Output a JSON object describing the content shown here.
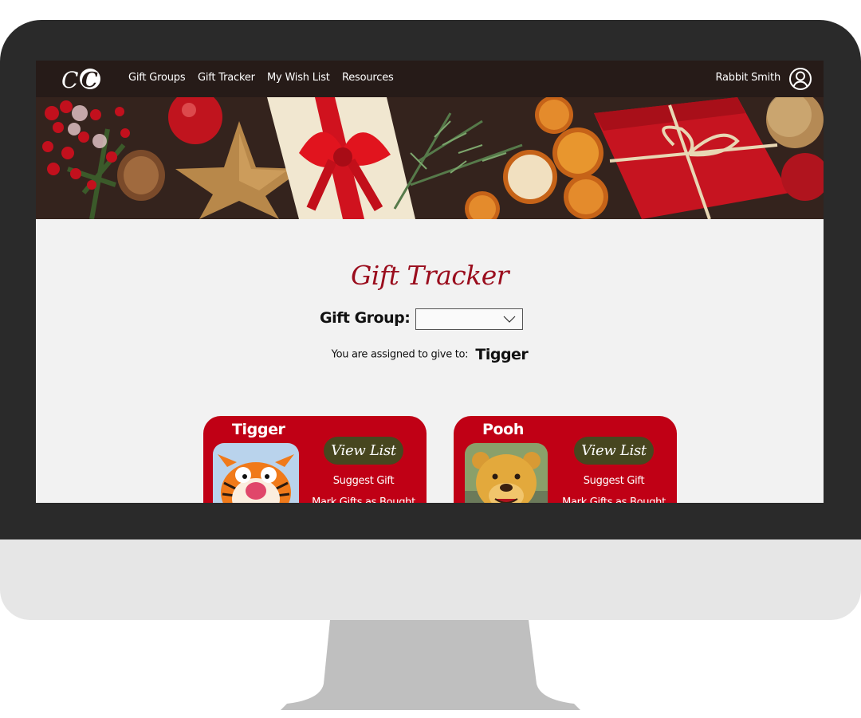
{
  "app": {
    "logo_text": "CC",
    "nav": [
      {
        "label": "Gift Groups"
      },
      {
        "label": "Gift Tracker"
      },
      {
        "label": "My Wish List"
      },
      {
        "label": "Resources"
      }
    ],
    "user_name": "Rabbit Smith",
    "user_icon": "user-circle-icon"
  },
  "page": {
    "title": "Gift Tracker",
    "gift_group_label": "Gift Group:",
    "gift_group_value": "",
    "assigned_label": "You are assigned to give to:",
    "assigned_name": "Tigger"
  },
  "cards": [
    {
      "name": "Tigger",
      "view_label": "View List",
      "suggest_label": "Suggest Gift",
      "mark_label": "Mark Gifts as Bought"
    },
    {
      "name": "Pooh",
      "view_label": "View List",
      "suggest_label": "Suggest Gift",
      "mark_label": "Mark Gifts as Bought"
    }
  ],
  "colors": {
    "nav_bg": "#261b18",
    "accent_red": "#c00015",
    "title_red": "#9a0d1d",
    "button_olive": "#47461f",
    "page_bg": "#f2f2f2"
  }
}
